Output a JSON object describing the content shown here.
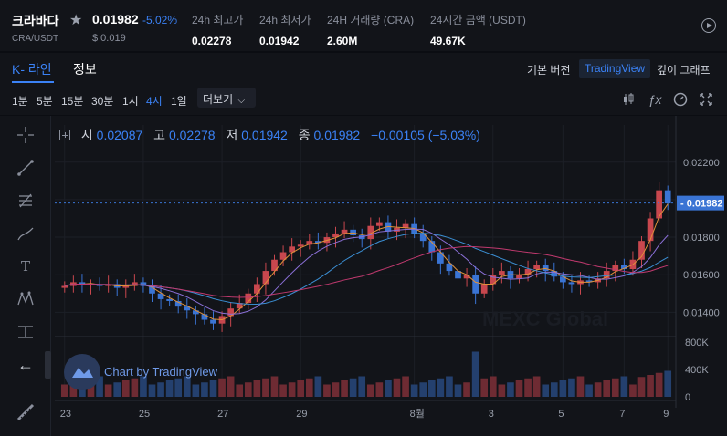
{
  "ticker": {
    "name": "크라바다",
    "pair": "CRA/USDT",
    "price": "0.01982",
    "change": "-5.02%",
    "price_usd": "$ 0.019",
    "stats": [
      {
        "label": "24h 최고가",
        "value": "0.02278"
      },
      {
        "label": "24h 최저가",
        "value": "0.01942"
      },
      {
        "label": "24H 거래량 (CRA)",
        "value": "2.60M"
      },
      {
        "label": "24시간 금액 (USDT)",
        "value": "49.67K"
      }
    ]
  },
  "tabs": {
    "kline": "K- 라인",
    "info": "정보",
    "basic": "기본 버전",
    "tradingview": "TradingView",
    "depth": "깊이 그래프"
  },
  "toolbar": {
    "intervals": [
      "1분",
      "5분",
      "15분",
      "30분",
      "1시",
      "4시",
      "1일"
    ],
    "active_interval": "4시",
    "more": "더보기",
    "icons": [
      "candle-type-icon",
      "indicator-fx-icon",
      "gauge-settings-icon",
      "fullscreen-icon"
    ]
  },
  "ohlc": {
    "open_label": "시",
    "open": "0.02087",
    "high_label": "고",
    "high": "0.02278",
    "low_label": "저",
    "low": "0.01942",
    "close_label": "종",
    "close": "0.01982",
    "change": "−0.00105 (−5.03%)"
  },
  "overlay": {
    "badge_text": "Chart by TradingView",
    "watermark": "MEXC Global"
  },
  "draw_tools": [
    "crosshair-icon",
    "trendline-icon",
    "fib-tool-icon",
    "brush-icon",
    "text-tool-icon",
    "pattern-icon",
    "measure-icon",
    "back-arrow-icon"
  ],
  "colors": {
    "up": "#c8474e",
    "down": "#3a74d4",
    "accent": "#3b82f6",
    "ma1": "#e0913a",
    "ma2": "#8a6fd6",
    "ma3": "#3b8fd4",
    "ma4": "#c0396e"
  },
  "chart_data": {
    "type": "candlestick",
    "x_ticks": [
      "23",
      "25",
      "27",
      "29",
      "8월",
      "3",
      "5",
      "7",
      "9"
    ],
    "price_axis": {
      "ticks": [
        "0.02200",
        "0.02000",
        "0.01800",
        "0.01600",
        "0.01400"
      ],
      "values": [
        0.022,
        0.02,
        0.018,
        0.016,
        0.014
      ],
      "range": [
        0.0128,
        0.0234
      ]
    },
    "last_price": {
      "label": "0.01982",
      "value": 0.01982
    },
    "volume_axis": {
      "ticks": [
        "800K",
        "400K",
        "0"
      ],
      "values": [
        800000,
        400000,
        0
      ],
      "max": 800000
    },
    "series": [
      {
        "name": "price",
        "values": [
          0.0154,
          0.0156,
          0.0155,
          0.0155,
          0.0154,
          0.0155,
          0.0153,
          0.0154,
          0.0156,
          0.0154,
          0.015,
          0.0147,
          0.0146,
          0.0143,
          0.0141,
          0.0139,
          0.0136,
          0.0134,
          0.0138,
          0.0142,
          0.0145,
          0.015,
          0.0155,
          0.0162,
          0.0168,
          0.0172,
          0.0175,
          0.0176,
          0.0178,
          0.0177,
          0.018,
          0.0182,
          0.0184,
          0.0181,
          0.0179,
          0.0186,
          0.0188,
          0.0183,
          0.0185,
          0.0187,
          0.0182,
          0.0178,
          0.0172,
          0.0166,
          0.0162,
          0.0158,
          0.016,
          0.015,
          0.0155,
          0.016,
          0.0162,
          0.0158,
          0.016,
          0.0163,
          0.0165,
          0.0162,
          0.0159,
          0.0156,
          0.0155,
          0.0157,
          0.0156,
          0.0158,
          0.0162,
          0.0165,
          0.0163,
          0.0168,
          0.0178,
          0.019,
          0.0205,
          0.0198
        ]
      }
    ]
  }
}
